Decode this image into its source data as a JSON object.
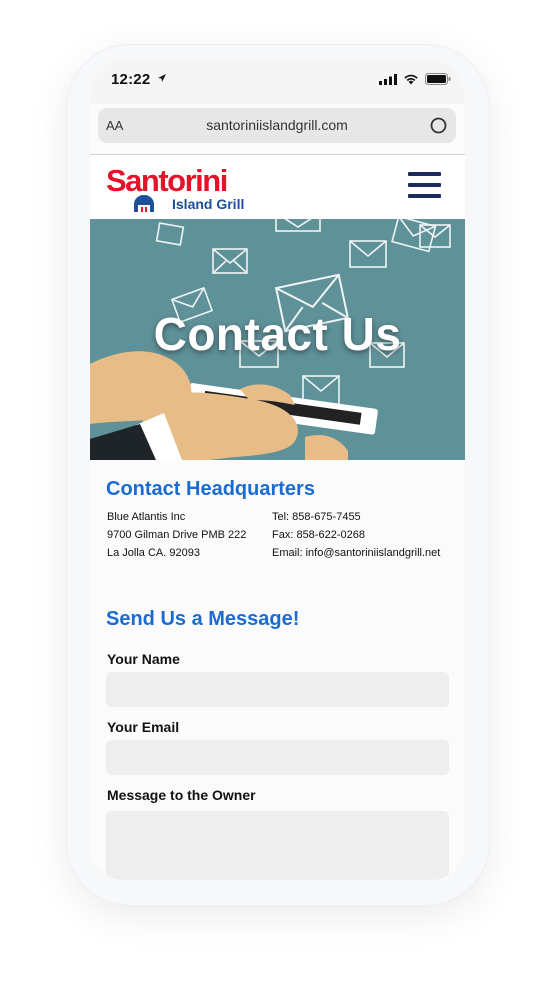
{
  "status_bar": {
    "time": "12:22"
  },
  "browser": {
    "text_size_label": "AA",
    "url": "santoriniislandgrill.com"
  },
  "brand": {
    "name": "Santorini",
    "tagline": "Island Grill"
  },
  "hero": {
    "title": "Contact Us"
  },
  "headquarters": {
    "heading": "Contact Headquarters",
    "address_lines": [
      "Blue Atlantis Inc",
      "9700 Gilman Drive PMB 222",
      "La Jolla CA. 92093"
    ],
    "tel": "Tel: 858-675-7455",
    "fax": "Fax: 858-622-0268",
    "email": "Email: info@santoriniislandgrill.net"
  },
  "form": {
    "heading": "Send Us a Message!",
    "name_label": "Your Name",
    "name_value": "",
    "email_label": "Your Email",
    "email_value": "",
    "message_label": "Message to the Owner",
    "message_value": ""
  },
  "colors": {
    "accent": "#1c6bd1",
    "brand_red": "#e4132a",
    "brand_blue": "#1d4f9a",
    "hero_bg": "#5f9199"
  }
}
